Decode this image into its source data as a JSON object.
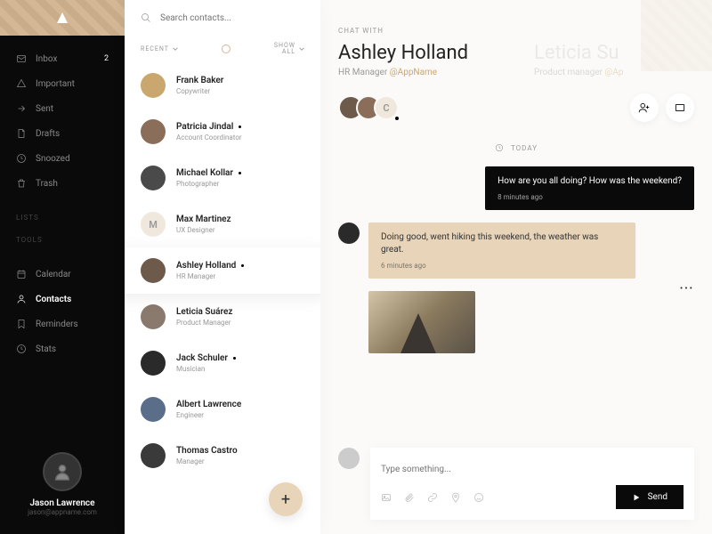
{
  "search": {
    "placeholder": "Search contacts..."
  },
  "nav": {
    "items": [
      {
        "label": "Inbox",
        "badge": "2"
      },
      {
        "label": "Important"
      },
      {
        "label": "Sent"
      },
      {
        "label": "Drafts"
      },
      {
        "label": "Snoozed"
      },
      {
        "label": "Trash"
      }
    ],
    "lists_header": "LISTS",
    "tools_header": "TOOLS",
    "tools": [
      {
        "label": "Calendar"
      },
      {
        "label": "Contacts"
      },
      {
        "label": "Reminders"
      },
      {
        "label": "Stats"
      }
    ]
  },
  "user": {
    "name": "Jason Lawrence",
    "email": "jason@appname.com"
  },
  "filters": {
    "recent": "RECENT",
    "show_all": "SHOW\nALL"
  },
  "contacts": [
    {
      "name": "Frank Baker",
      "role": "Copywriter",
      "color": "#c9a76e"
    },
    {
      "name": "Patricia Jindal",
      "role": "Account Coordinator",
      "color": "#8a6e5a",
      "dot": true
    },
    {
      "name": "Michael Kollar",
      "role": "Photographer",
      "color": "#4a4a4a",
      "dot": true
    },
    {
      "name": "Max Martinez",
      "role": "UX Designer",
      "color": "#f0e8dc",
      "initial": "M"
    },
    {
      "name": "Ashley Holland",
      "role": "HR Manager",
      "color": "#6e5a4a",
      "dot": true,
      "selected": true
    },
    {
      "name": "Leticia Suárez",
      "role": "Product Manager",
      "color": "#8a7a6e"
    },
    {
      "name": "Jack Schuler",
      "role": "Musician",
      "color": "#2a2a2a",
      "dot": true
    },
    {
      "name": "Albert Lawrence",
      "role": "Engineer",
      "color": "#5a6e8a"
    },
    {
      "name": "Thomas Castro",
      "role": "Manager",
      "color": "#3a3a3a"
    }
  ],
  "chat": {
    "label": "CHAT WITH",
    "primary": {
      "name": "Ashley Holland",
      "role": "HR Manager",
      "handle": "@AppName"
    },
    "secondary": {
      "name": "Leticia Su",
      "role": "Product manager",
      "handle": "@Ap"
    },
    "today": "TODAY",
    "messages": [
      {
        "side": "right",
        "text": "How are you all doing? How was the weekend?",
        "time": "8 minutes ago"
      },
      {
        "side": "left",
        "text": "Doing good, went hiking this weekend, the weather was great.",
        "time": "6 minutes ago"
      }
    ],
    "composer_placeholder": "Type something...",
    "send": "Send",
    "avatar_initial": "C"
  }
}
